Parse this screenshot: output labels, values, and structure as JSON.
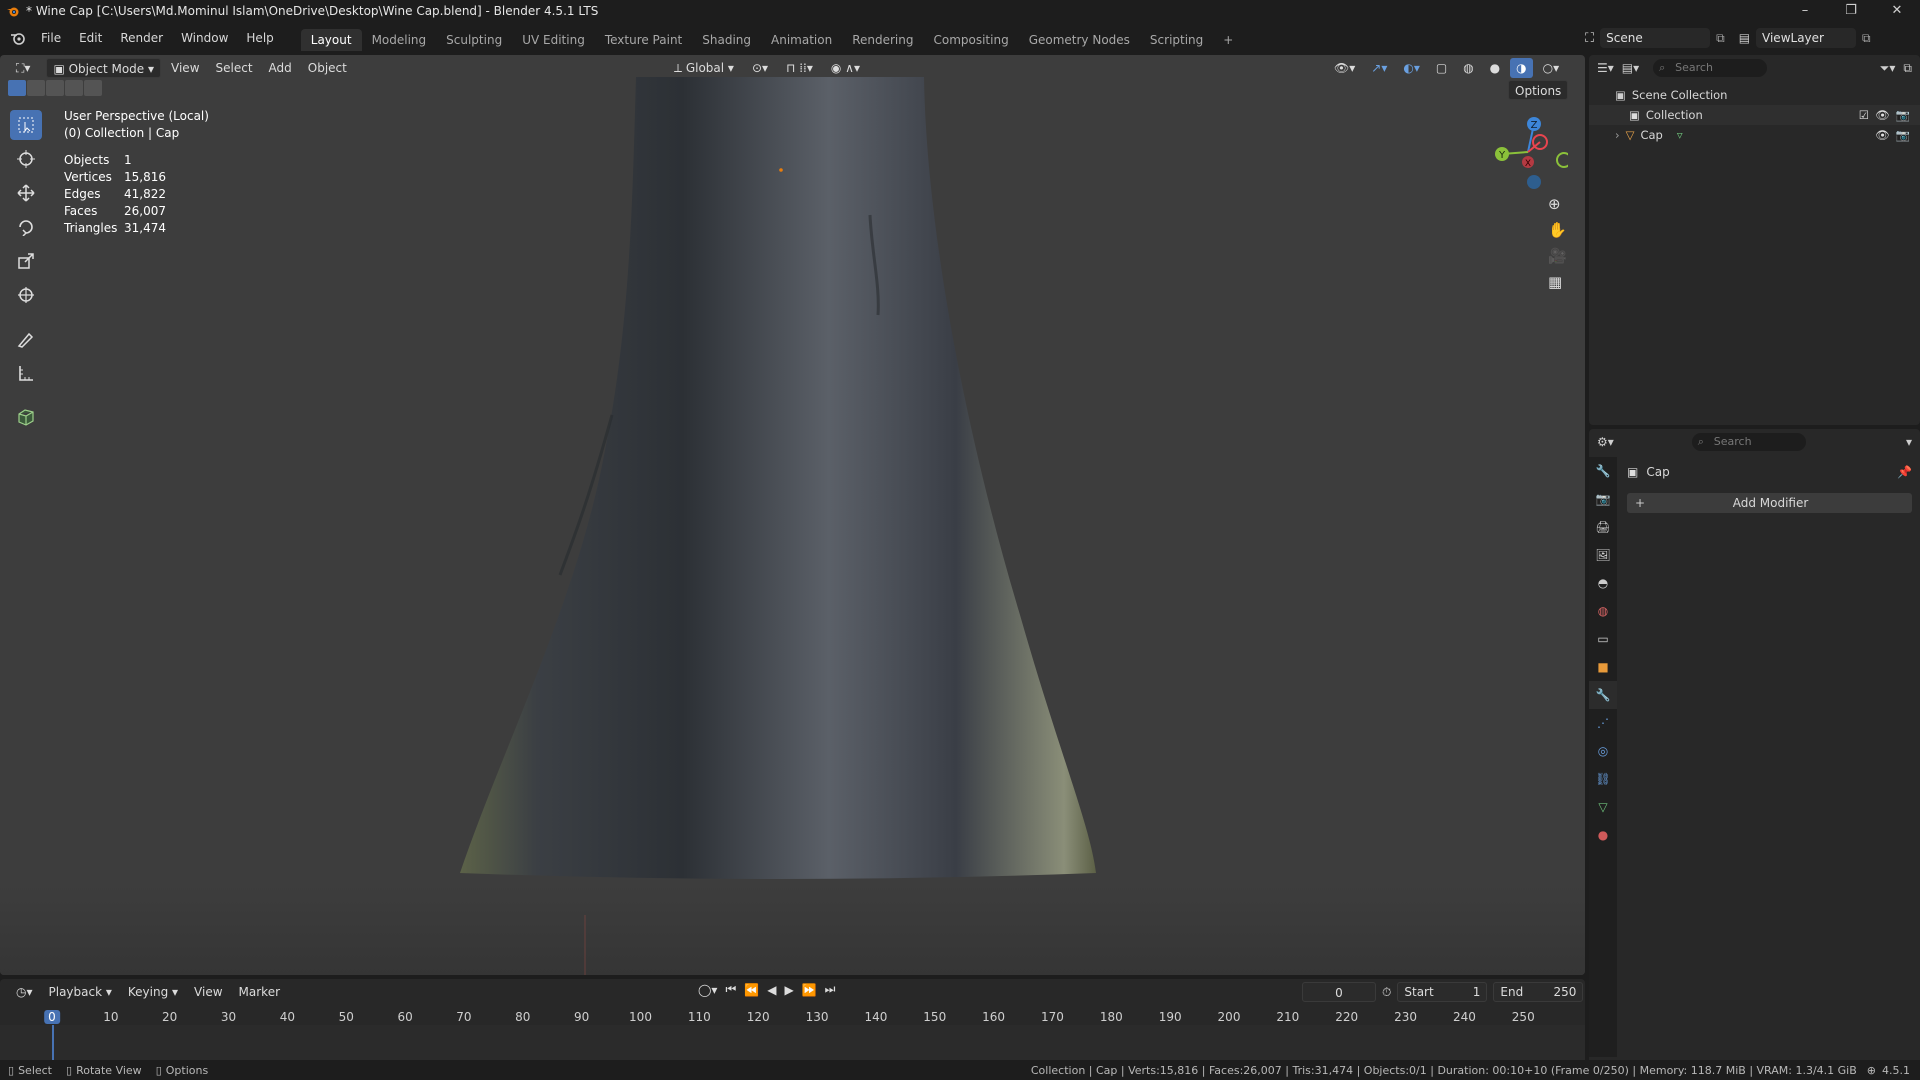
{
  "window": {
    "title": "* Wine Cap [C:\\Users\\Md.Mominul Islam\\OneDrive\\Desktop\\Wine Cap.blend] - Blender 4.5.1 LTS",
    "controls": [
      "–",
      "❐",
      "✕"
    ]
  },
  "menu": [
    "File",
    "Edit",
    "Render",
    "Window",
    "Help"
  ],
  "workspaces": [
    "Layout",
    "Modeling",
    "Sculpting",
    "UV Editing",
    "Texture Paint",
    "Shading",
    "Animation",
    "Rendering",
    "Compositing",
    "Geometry Nodes",
    "Scripting"
  ],
  "active_workspace": "Layout",
  "scene": {
    "name": "Scene",
    "view_layer": "ViewLayer"
  },
  "viewport": {
    "mode": "Object Mode",
    "header_menus": [
      "View",
      "Select",
      "Add",
      "Object"
    ],
    "orientation": "Global",
    "options_label": "Options",
    "overlay_title": "User Perspective (Local)",
    "overlay_subtitle": "(0) Collection | Cap",
    "stats": [
      {
        "label": "Objects",
        "value": "1"
      },
      {
        "label": "Vertices",
        "value": "15,816"
      },
      {
        "label": "Edges",
        "value": "41,822"
      },
      {
        "label": "Faces",
        "value": "26,007"
      },
      {
        "label": "Triangles",
        "value": "31,474"
      }
    ],
    "gizmo_axes": {
      "z": "Z",
      "y": "Y",
      "x": "X"
    },
    "colors": {
      "background": "#3d3d3d",
      "selection": "#4772b3",
      "axis_x": "#e8454f",
      "axis_y": "#8bc13a",
      "axis_z": "#3d86d9"
    }
  },
  "outliner": {
    "search_placeholder": "Search",
    "root": "Scene Collection",
    "items": [
      {
        "name": "Collection",
        "type": "collection"
      },
      {
        "name": "Cap",
        "type": "mesh"
      }
    ]
  },
  "properties": {
    "search_placeholder": "Search",
    "object_name": "Cap",
    "add_modifier_label": "Add Modifier"
  },
  "timeline": {
    "menus": [
      "Playback",
      "Keying",
      "View",
      "Marker"
    ],
    "current_frame": "0",
    "start_label": "Start",
    "start_value": "1",
    "end_label": "End",
    "end_value": "250",
    "ruler": [
      "0",
      "10",
      "20",
      "30",
      "40",
      "50",
      "60",
      "70",
      "80",
      "90",
      "100",
      "110",
      "120",
      "130",
      "140",
      "150",
      "160",
      "170",
      "180",
      "190",
      "200",
      "210",
      "220",
      "230",
      "240",
      "250"
    ]
  },
  "statusbar": {
    "left": [
      "Select",
      "Rotate View",
      "Options"
    ],
    "right": "Collection | Cap | Verts:15,816 | Faces:26,007 | Tris:31,474 | Objects:0/1 | Duration: 00:10+10 (Frame 0/250) | Memory: 118.7 MiB | VRAM: 1.3/4.1 GiB",
    "version": "4.5.1"
  }
}
